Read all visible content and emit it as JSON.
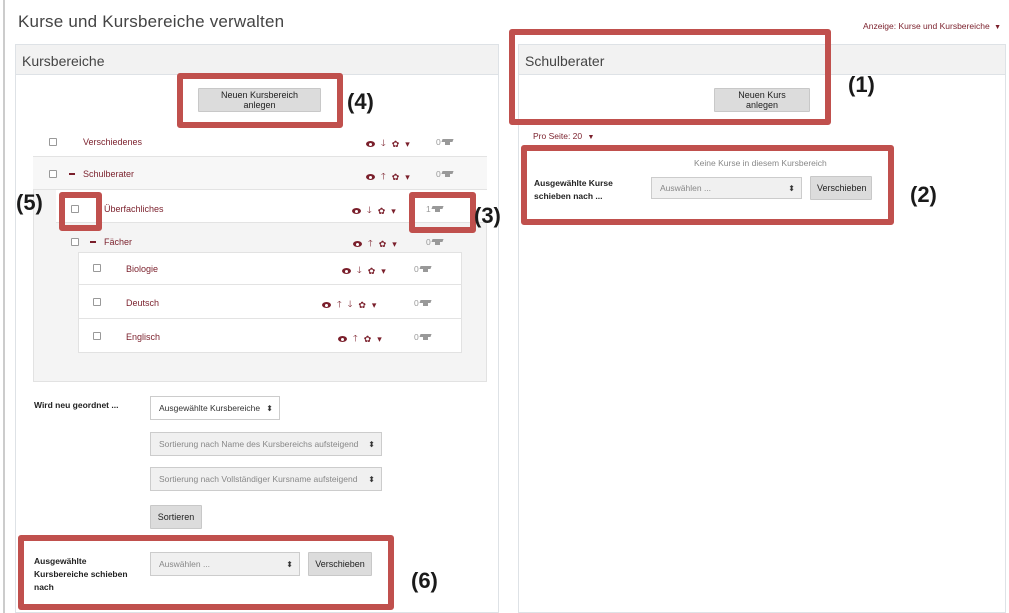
{
  "page": {
    "title": "Kurse und Kursbereiche verwalten",
    "view_label": "Anzeige: Kurse und Kursbereiche",
    "view_caret": "▼"
  },
  "categories_panel": {
    "title": "Kursbereiche",
    "new_category_button": "Neuen Kursbereich anlegen",
    "rows": [
      {
        "name": "Verschiedenes",
        "count": "0"
      },
      {
        "name": "Schulberater",
        "count": "0"
      },
      {
        "name": "Überfachliches",
        "count": "1"
      },
      {
        "name": "Fächer",
        "count": "0"
      },
      {
        "name": "Biologie",
        "count": "0"
      },
      {
        "name": "Deutsch",
        "count": "0"
      },
      {
        "name": "Englisch",
        "count": "0"
      }
    ],
    "resort": {
      "label": "Wird neu geordnet ...",
      "select_scope": "Ausgewählte Kursbereiche",
      "select_sort_categories": "Sortierung nach Name des Kursbereichs aufsteigend",
      "select_sort_courses": "Sortierung nach Vollständiger Kursname aufsteigend",
      "sort_button": "Sortieren"
    },
    "move": {
      "label": "Ausgewählte Kursbereiche schieben nach",
      "select_placeholder": "Auswählen ...",
      "move_button": "Verschieben"
    }
  },
  "courses_panel": {
    "title": "Schulberater",
    "new_course_button": "Neuen Kurs anlegen",
    "per_page": "Pro Seite: 20",
    "per_page_caret": "▼",
    "empty_text": "Keine Kurse in diesem Kursbereich",
    "move": {
      "label": "Ausgewählte Kurse schieben nach ...",
      "select_placeholder": "Auswählen ...",
      "move_button": "Verschieben"
    }
  },
  "callouts": [
    "(1)",
    "(2)",
    "(3)",
    "(4)",
    "(5)",
    "(6)"
  ],
  "icons": {
    "select_arrow": "⬍",
    "arrow_down": "🡓",
    "arrow_up": "🡑",
    "gear": "✿",
    "menu_caret": "▾"
  },
  "colors": {
    "accent": "#7a1f2b",
    "annotation": "#c0504d"
  }
}
